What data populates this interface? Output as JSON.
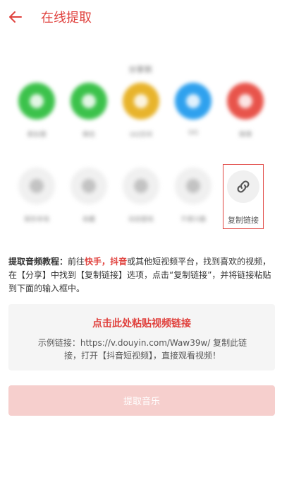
{
  "header": {
    "title": "在线提取"
  },
  "share_sheet": {
    "title": "分享到",
    "row1": [
      {
        "label": "朋友圈",
        "color": "#3cc24b"
      },
      {
        "label": "微信",
        "color": "#3cc24b"
      },
      {
        "label": "QQ空间",
        "color": "#e8b42c"
      },
      {
        "label": "QQ",
        "color": "#2fa1ee"
      },
      {
        "label": "微博",
        "color": "#e8544b"
      }
    ],
    "row2": [
      {
        "label": "保存本地"
      },
      {
        "label": "收藏"
      },
      {
        "label": "动态壁纸"
      },
      {
        "label": "不感兴趣"
      }
    ],
    "copy_link_label": "复制链接"
  },
  "tutorial": {
    "label": "提取音频教程：",
    "t1": "前往",
    "kuaishou": "快手",
    "sep": "，",
    "douyin": "抖音",
    "t2": "或其他短视频平台，找到喜欢的视频，在【分享】中找到【复制链接】选项，点击“复制链接”，并将链接粘贴到下面的输入框中。"
  },
  "paste": {
    "title": "点击此处粘贴视频链接",
    "example": "示例链接：https://v.douyin.com/Waw39w/ 复制此链接，打开【抖音短视频】，直接观看视频！"
  },
  "extract_button": "提取音乐",
  "colors": {
    "accent": "#e0423e",
    "button_disabled": "#f6cfcd"
  }
}
